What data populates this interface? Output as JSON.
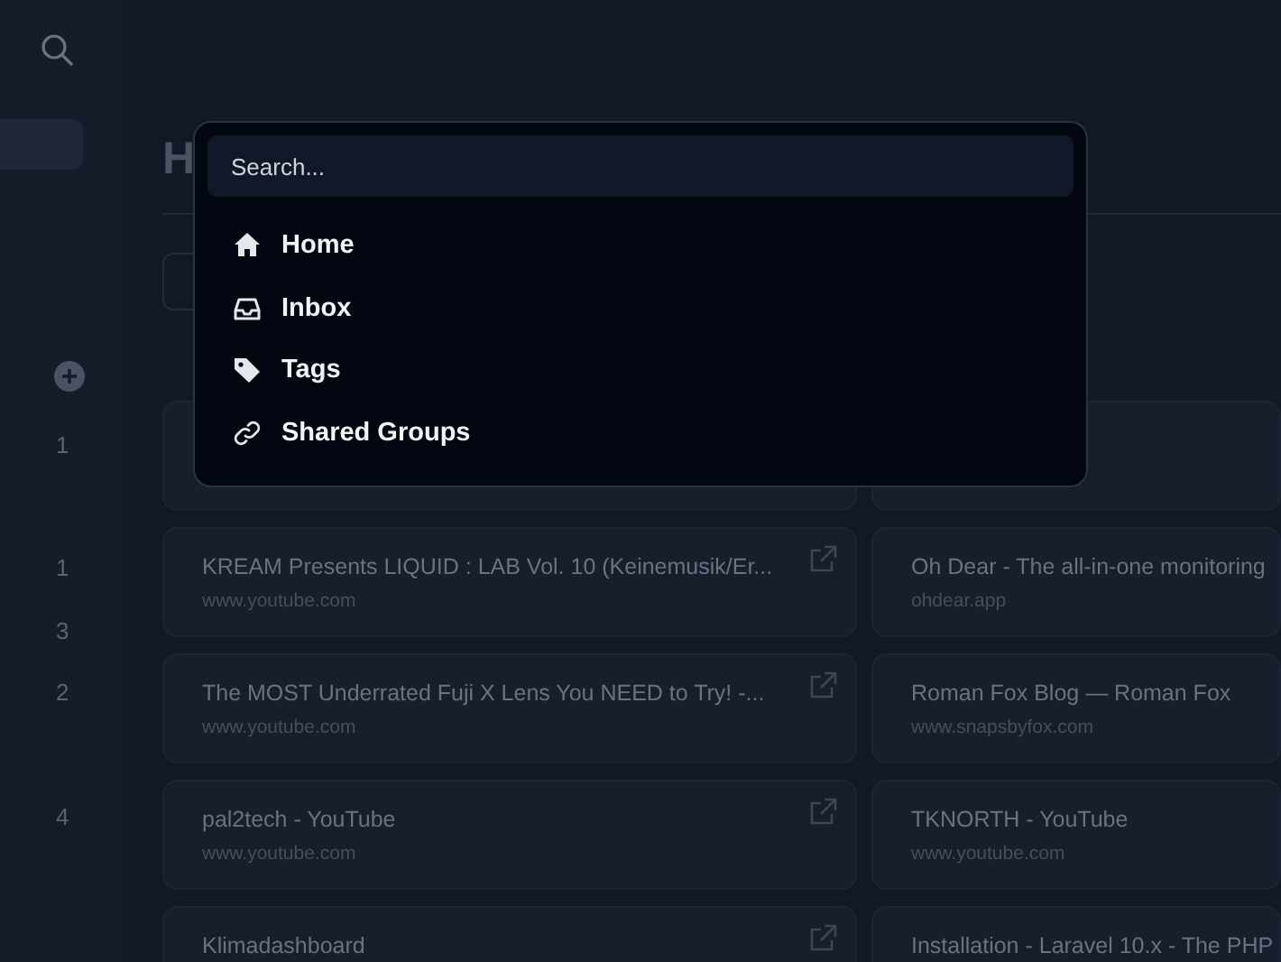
{
  "sidebar": {
    "counts": [
      "1",
      "1",
      "3",
      "2",
      "4"
    ]
  },
  "page": {
    "title": "H"
  },
  "bookmarks": [
    {
      "title": "KREAM Presents LIQUID : LAB Vol. 10 (Keinemusik/Er...",
      "url": "www.youtube.com"
    },
    {
      "title": "Oh Dear - The all-in-one monitoring",
      "url": "ohdear.app"
    },
    {
      "title": "The MOST Underrated Fuji X Lens You NEED to Try! -...",
      "url": "www.youtube.com"
    },
    {
      "title": "Roman Fox Blog — Roman Fox",
      "url": "www.snapsbyfox.com"
    },
    {
      "title": "pal2tech - YouTube",
      "url": "www.youtube.com"
    },
    {
      "title": "TKNORTH - YouTube",
      "url": "www.youtube.com"
    },
    {
      "title": "Klimadashboard"
    },
    {
      "title": "Installation - Laravel 10.x - The PHP"
    }
  ],
  "palette": {
    "search": {
      "placeholder": "Search..."
    },
    "items": [
      {
        "label": "Home",
        "kind": "home"
      },
      {
        "label": "Inbox",
        "kind": "inbox"
      },
      {
        "label": "Tags",
        "kind": "tag"
      },
      {
        "label": "Shared Groups",
        "kind": "link"
      }
    ]
  }
}
